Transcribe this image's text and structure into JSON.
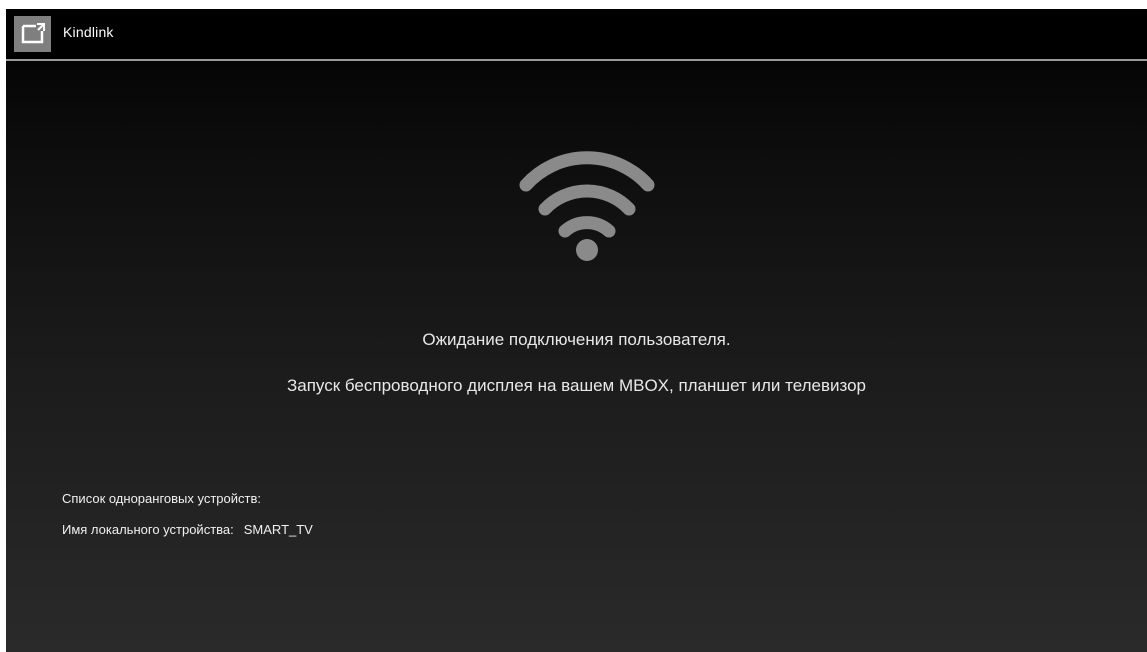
{
  "app": {
    "title": "Kindlink",
    "icon": "cast-screen-icon"
  },
  "status": {
    "icon": "wifi-icon",
    "waiting_text": "Ожидание подключения пользователя.",
    "hint_text": "Запуск беспроводного дисплея на вашем MBOX, планшет или телевизор"
  },
  "devices": {
    "peer_list_label": "Список одноранговых устройств:",
    "local_name_label": "Имя локального устройства:",
    "local_name_value": "SMART_TV"
  },
  "colors": {
    "titlebar": "#000000",
    "divider": "#9a9a9a",
    "icon_bg": "#7f7f7f",
    "wifi": "#8a8a8a",
    "text": "#e8e8e8"
  }
}
